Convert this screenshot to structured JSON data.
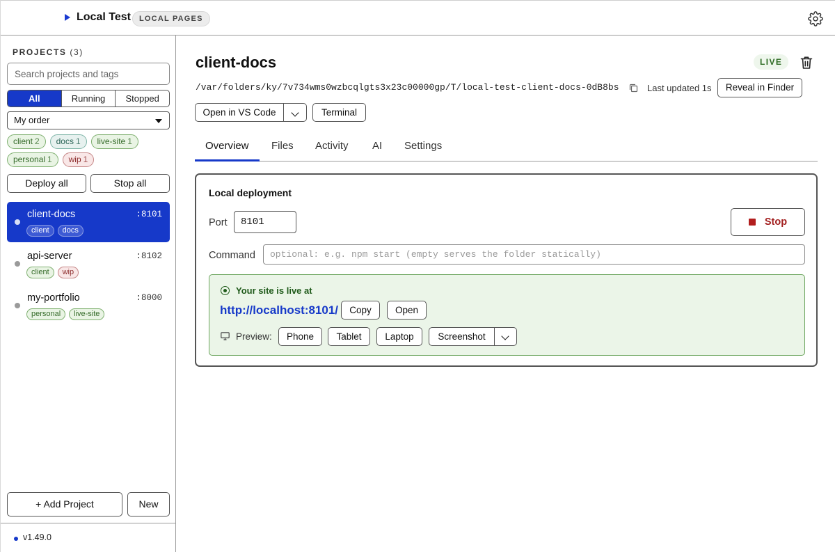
{
  "header": {
    "title": "Local Test",
    "badge": "LOCAL PAGES",
    "icons": {
      "play": "play-triangle-icon",
      "settings": "gear-icon"
    },
    "colors": {
      "accent": "#1639c9"
    }
  },
  "sidebar": {
    "heading": "PROJECTS",
    "count": "(3)",
    "search_placeholder": "Search projects and tags",
    "filters": [
      "All",
      "Running",
      "Stopped"
    ],
    "active_filter": "All",
    "order": "My order",
    "tags": [
      {
        "name": "client",
        "count": "2",
        "color": "green"
      },
      {
        "name": "docs",
        "count": "1",
        "color": "teal"
      },
      {
        "name": "live-site",
        "count": "1",
        "color": "green"
      },
      {
        "name": "personal",
        "count": "1",
        "color": "green"
      },
      {
        "name": "wip",
        "count": "1",
        "color": "red"
      }
    ],
    "deploy_all": "Deploy all",
    "stop_all": "Stop all",
    "projects": [
      {
        "name": "client-docs",
        "port": ":8101",
        "tags": [
          "client",
          "docs"
        ],
        "selected": true
      },
      {
        "name": "api-server",
        "port": ":8102",
        "tags": [
          "client",
          "wip"
        ],
        "selected": false
      },
      {
        "name": "my-portfolio",
        "port": ":8000",
        "tags": [
          "personal",
          "live-site"
        ],
        "selected": false
      }
    ],
    "add_project": "+ Add Project",
    "new": "New",
    "version": "v1.49.0"
  },
  "main": {
    "title": "client-docs",
    "status": "LIVE",
    "path": "/var/folders/ky/7v734wms0wzbcqlgts3x23c00000gp/T/local-test-client-docs-0dB8bs",
    "last_updated": "Last updated 1s",
    "reveal": "Reveal in Finder",
    "open_vscode": "Open in VS Code",
    "terminal": "Terminal",
    "tabs": [
      "Overview",
      "Files",
      "Activity",
      "AI",
      "Settings"
    ],
    "active_tab": "Overview",
    "deployment": {
      "title": "Local deployment",
      "port_label": "Port",
      "port_value": "8101",
      "stop": "Stop",
      "command_label": "Command",
      "command_placeholder": "optional: e.g. npm start (empty serves the folder statically)",
      "live_text": "Your site is live at",
      "url": "http://localhost:8101/",
      "copy": "Copy",
      "open": "Open",
      "preview_label": "Preview:",
      "preview_options": [
        "Phone",
        "Tablet",
        "Laptop",
        "Screenshot"
      ]
    }
  }
}
